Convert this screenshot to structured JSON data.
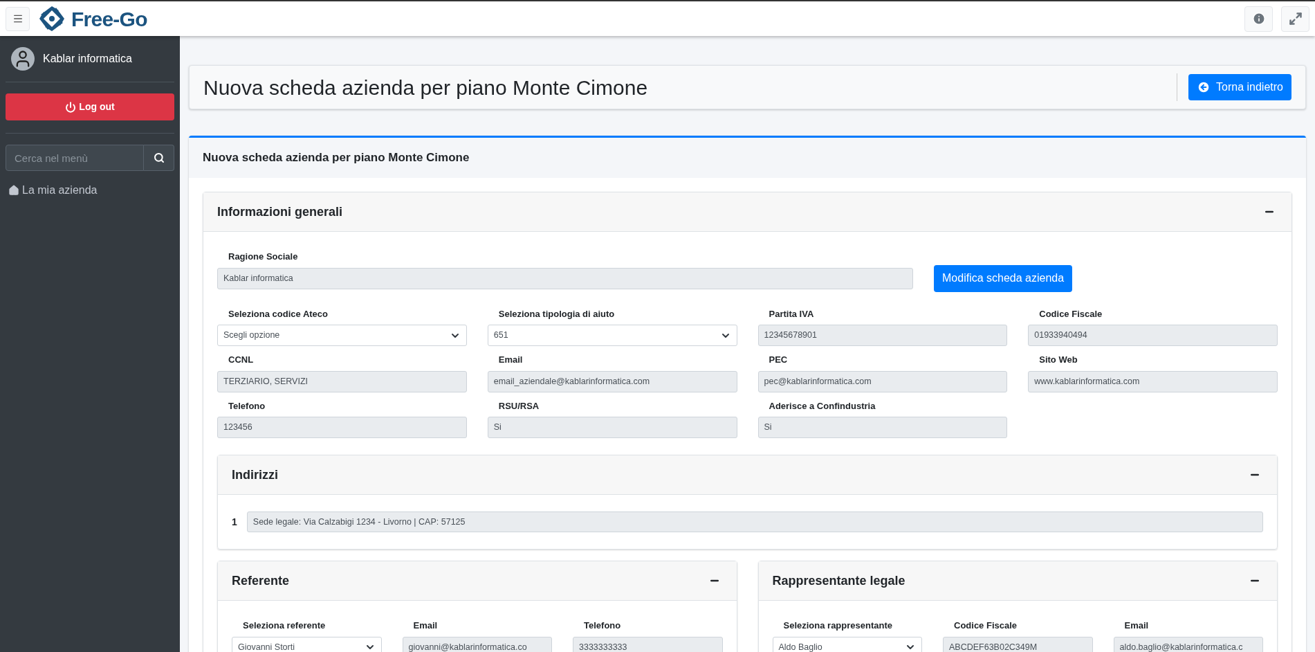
{
  "topbar": {
    "logo": "Free-Go"
  },
  "sidebar": {
    "user": "Kablar informatica",
    "logout": "Log out",
    "search": {
      "placeholder": "Cerca nel menù"
    },
    "items": [
      {
        "label": "La mia azienda"
      }
    ]
  },
  "page_header": {
    "title": "Nuova scheda azienda per piano Monte Cimone",
    "back_button": "Torna indietro"
  },
  "card": {
    "title": "Nuova scheda azienda per piano Monte Cimone",
    "general": {
      "title": "Informazioni generali",
      "name_field": {
        "label": "Ragione Sociale",
        "value": "Kablar informatica"
      },
      "edit_button": "Modifica scheda azienda",
      "fields": [
        {
          "label": "Seleziona codice Ateco",
          "value": "Scegli opzione",
          "kind": "select"
        },
        {
          "label": "Seleziona tipologia di aiuto",
          "value": "651",
          "kind": "select"
        },
        {
          "label": "Partita IVA",
          "value": "12345678901",
          "kind": "text"
        },
        {
          "label": "Codice Fiscale",
          "value": "01933940494",
          "kind": "text"
        },
        {
          "label": "CCNL",
          "value": "TERZIARIO, SERVIZI",
          "kind": "text"
        },
        {
          "label": "Email",
          "value": "email_aziendale@kablarinformatica.com",
          "kind": "text"
        },
        {
          "label": "PEC",
          "value": "pec@kablarinformatica.com",
          "kind": "text"
        },
        {
          "label": "Sito Web",
          "value": "www.kablarinformatica.com",
          "kind": "text"
        },
        {
          "label": "Telefono",
          "value": "123456",
          "kind": "text"
        },
        {
          "label": "RSU/RSA",
          "value": "Si",
          "kind": "text"
        },
        {
          "label": "Aderisce a Confindustria",
          "value": "Si",
          "kind": "text"
        }
      ]
    },
    "addresses": {
      "title": "Indirizzi",
      "items": [
        {
          "index": "1",
          "value": "Sede legale: Via Calzabigi 1234 - Livorno | CAP: 57125"
        }
      ]
    },
    "people": [
      {
        "title": "Referente",
        "fields": [
          {
            "label": "Seleziona referente",
            "value": "Giovanni Storti",
            "kind": "select"
          },
          {
            "label": "Email",
            "value": "giovanni@kablarinformatica.co",
            "kind": "text"
          },
          {
            "label": "Telefono",
            "value": "3333333333",
            "kind": "text"
          }
        ]
      },
      {
        "title": "Rappresentante legale",
        "fields": [
          {
            "label": "Seleziona rappresentante",
            "value": "Aldo Baglio",
            "kind": "select"
          },
          {
            "label": "Codice Fiscale",
            "value": "ABCDEF63B02C349M",
            "kind": "text"
          },
          {
            "label": "Email",
            "value": "aldo.baglio@kablarinformatica.c",
            "kind": "text"
          }
        ]
      }
    ]
  }
}
